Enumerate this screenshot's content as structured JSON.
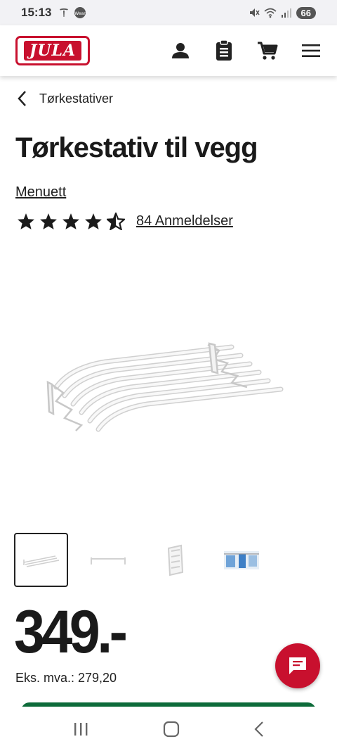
{
  "status_bar": {
    "time": "15:13",
    "battery": "66"
  },
  "header": {
    "logo_text": "JULA",
    "icons": [
      "user-icon",
      "clipboard-icon",
      "cart-icon",
      "menu-icon"
    ]
  },
  "breadcrumb": {
    "label": "Tørkestativer"
  },
  "product": {
    "title": "Tørkestativ til vegg",
    "brand": "Menuett",
    "rating": 4.5,
    "rating_max": 5,
    "reviews_label": "84 Anmeldelser",
    "thumbnails_count": 4,
    "active_thumbnail": 1,
    "price": "349.-",
    "ex_vat": "Eks. mva.: 279,20"
  },
  "colors": {
    "brand_red": "#c8102e",
    "buy_green": "#0d6b3a"
  }
}
